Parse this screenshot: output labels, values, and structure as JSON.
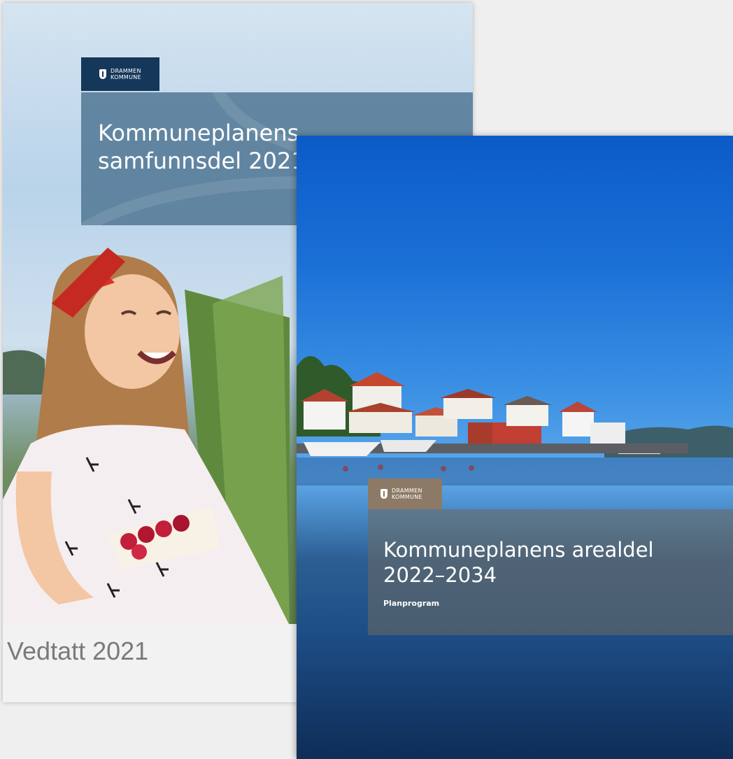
{
  "back_document": {
    "logo_line1": "DRAMMEN",
    "logo_line2": "KOMMUNE",
    "title_line1": "Kommuneplanens",
    "title_line2": "samfunnsdel 2021",
    "caption": "Vedtatt 2021"
  },
  "front_document": {
    "logo_line1": "DRAMMEN",
    "logo_line2": "KOMMUNE",
    "title_line1": "Kommuneplanens arealdel",
    "title_line2": "2022–2034",
    "subtitle": "Planprogram"
  },
  "colors": {
    "logo_back_bg": "#15375a",
    "logo_front_bg": "#8c7a66",
    "caption_text": "#7a7a7a",
    "sky": "#1a6fd6",
    "sea": "#1d4d86"
  },
  "icons": {
    "logo": "drammen-kommune-shield-icon"
  }
}
